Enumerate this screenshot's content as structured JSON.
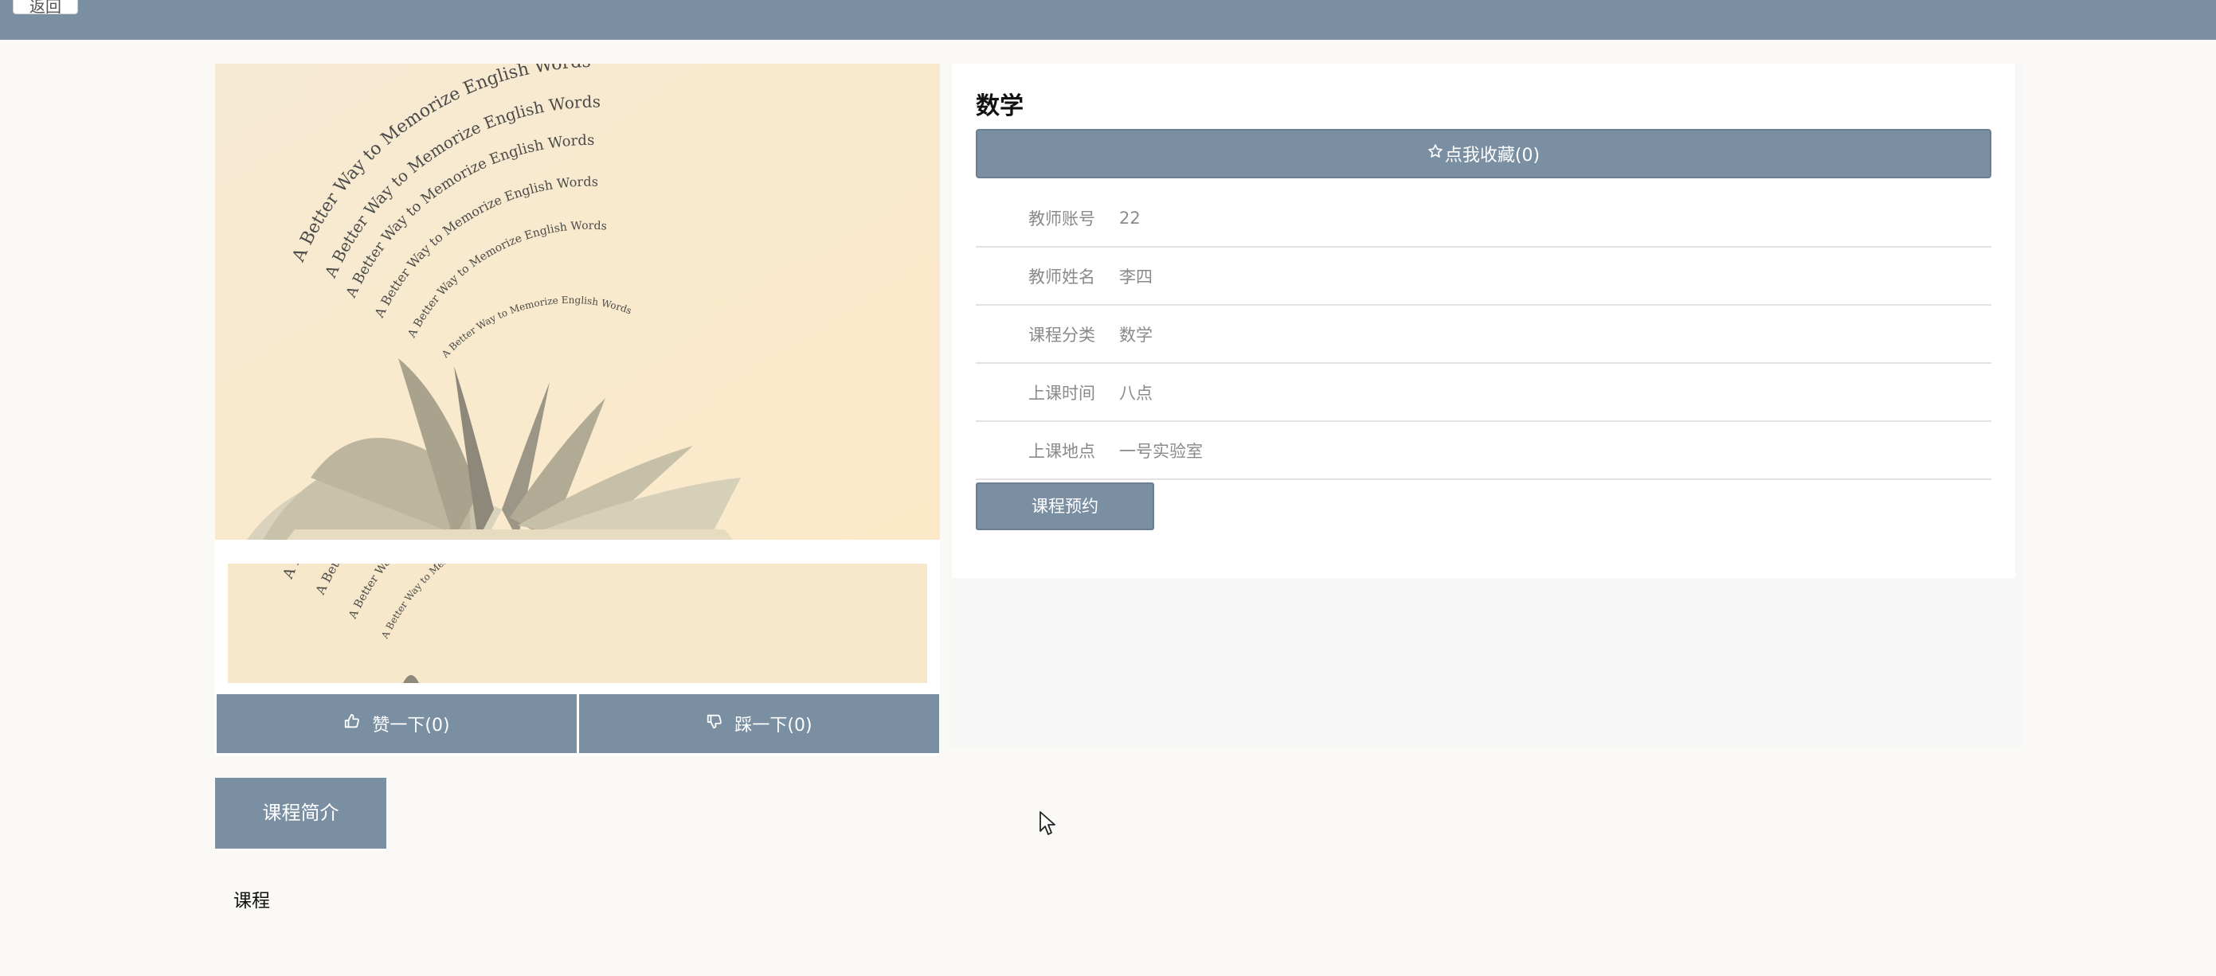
{
  "header": {
    "back_label": "返回"
  },
  "gallery": {
    "image_text": "A Better Way to Memorize English Words"
  },
  "votes": {
    "like_label": "赞一下(0)",
    "dislike_label": "踩一下(0)"
  },
  "course": {
    "title": "数学",
    "favorite_label": "点我收藏(0)",
    "rows": [
      {
        "label": "教师账号",
        "value": "22"
      },
      {
        "label": "教师姓名",
        "value": "李四"
      },
      {
        "label": "课程分类",
        "value": "数学"
      },
      {
        "label": "上课时间",
        "value": "八点"
      },
      {
        "label": "上课地点",
        "value": "一号实验室"
      }
    ],
    "reserve_label": "课程预约"
  },
  "intro": {
    "tab_label": "课程简介",
    "content": "课程"
  },
  "colors": {
    "accent": "#7a8fa2",
    "background": "#fbf9f6"
  }
}
